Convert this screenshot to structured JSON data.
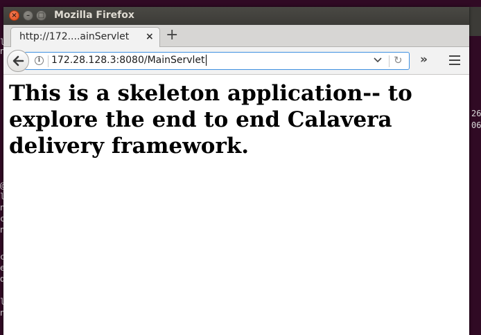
{
  "window": {
    "title": "Mozilla Firefox",
    "controls": {
      "close": "×",
      "minimize": "–",
      "maximize": "□"
    }
  },
  "tabs": [
    {
      "label": "http://172....ainServlet",
      "close": "×"
    }
  ],
  "newtab_label": "+",
  "navbar": {
    "url": "172.28.128.3:8080/MainServlet",
    "info_icon": "i",
    "dropdown_icon": "chevron-down-icon",
    "reload_icon": "↻",
    "overflow_label": "»"
  },
  "page": {
    "heading": "This is a skeleton application-- to explore the end to end Calavera delivery framework."
  },
  "terminal": {
    "right_fragments": [
      "26",
      "06"
    ],
    "left_fragments": [
      "l",
      "n",
      "c",
      "n",
      "@",
      "l",
      "n",
      "c",
      "n",
      "",
      "l",
      "c",
      "e",
      "d",
      "",
      "l",
      "n"
    ]
  },
  "colors": {
    "terminal_bg": "#300a24",
    "titlebar": "#3c3b37",
    "close_button": "#df4a16",
    "url_focus_border": "#3d8fe0"
  }
}
